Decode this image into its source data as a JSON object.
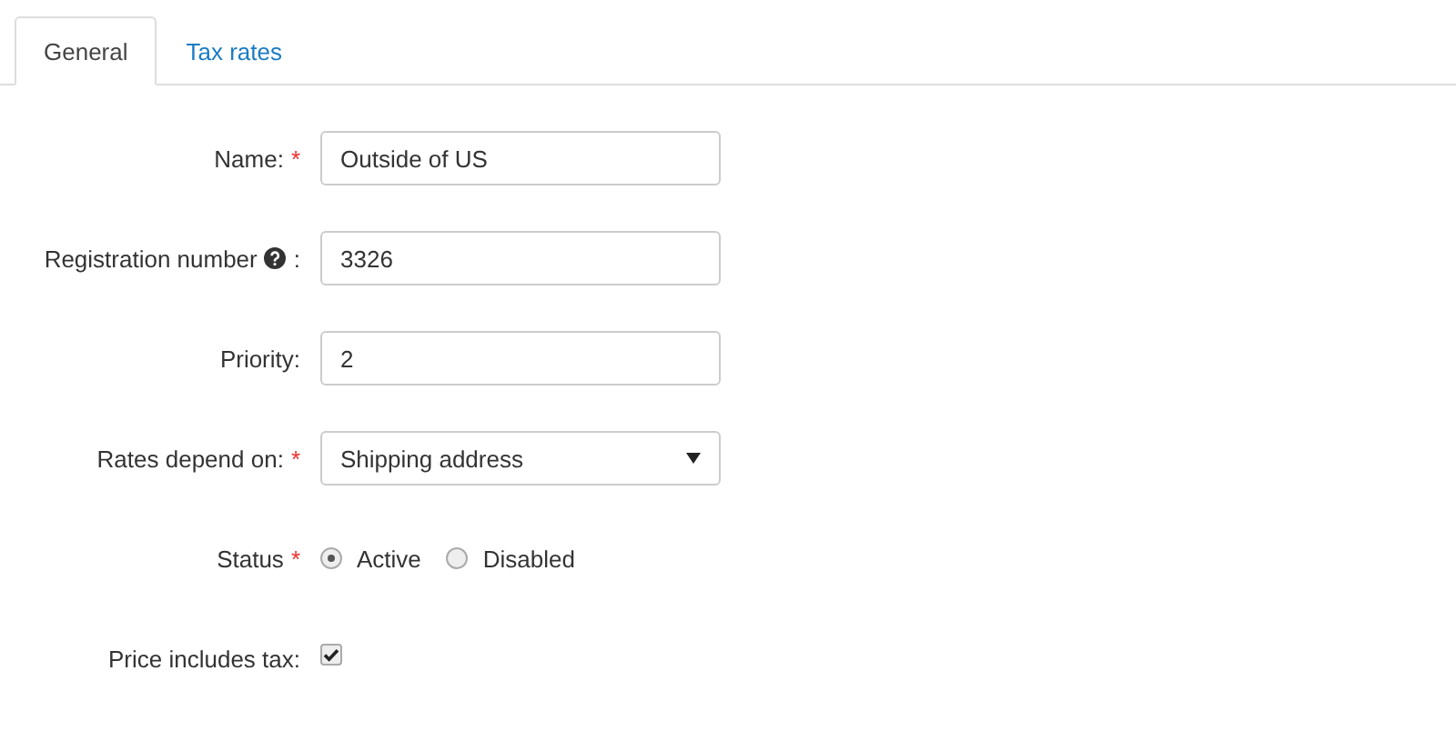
{
  "tabs": [
    {
      "label": "General",
      "selected": true
    },
    {
      "label": "Tax rates",
      "selected": false
    }
  ],
  "fields": [
    {
      "kind": "text",
      "label": "Name:",
      "required_mark": "*",
      "value": "Outside of US"
    },
    {
      "kind": "text",
      "label": "Registration number",
      "help": true,
      "suffix": ":",
      "value": "3326"
    },
    {
      "kind": "text",
      "label": "Priority:",
      "value": "2"
    },
    {
      "kind": "select",
      "label": "Rates depend on:",
      "required_mark": "*",
      "value": "Shipping address"
    },
    {
      "kind": "radio",
      "label": "Status",
      "required_mark": "*",
      "options": [
        {
          "label": "Active",
          "selected": true
        },
        {
          "label": "Disabled",
          "selected": false
        }
      ]
    },
    {
      "kind": "checkbox",
      "label": "Price includes tax:",
      "checked": true
    }
  ]
}
